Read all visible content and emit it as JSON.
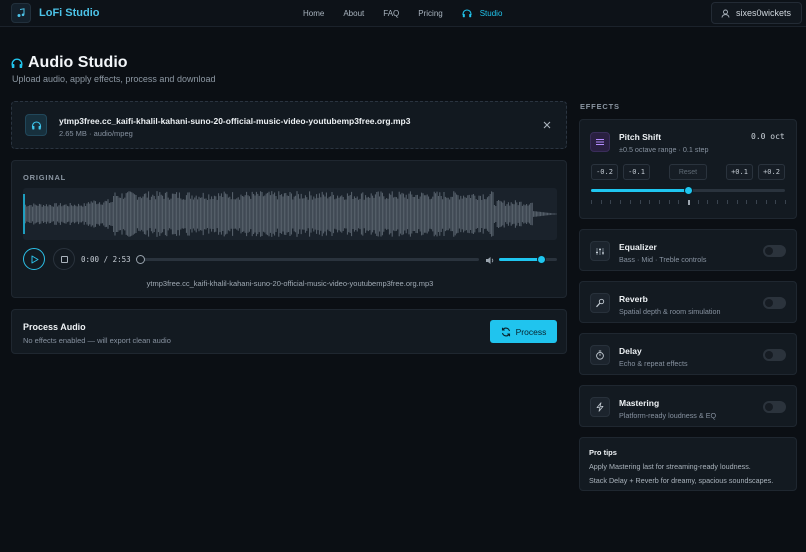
{
  "nav": {
    "brand": "LoFi Studio",
    "links": [
      "Home",
      "About",
      "FAQ",
      "Pricing"
    ],
    "active_link": "Studio",
    "username": "sixes0wickets"
  },
  "header": {
    "title": "Audio Studio",
    "subtitle": "Upload audio, apply effects, process and download"
  },
  "file": {
    "name": "ytmp3free.cc_kaifi-khalil-kahani-suno-20-official-music-video-youtubemp3free.org.mp3",
    "meta": "2.65 MB · audio/mpeg"
  },
  "player": {
    "label": "ORIGINAL",
    "time": "0:00 / 2:53",
    "progress": 0,
    "volume": 0.72,
    "filename": "ytmp3free.cc_kaifi-khalil-kahani-suno-20-official-music-video-youtubemp3free.org.mp3"
  },
  "process": {
    "title": "Process Audio",
    "subtitle": "No effects enabled — will export clean audio",
    "button": "Process"
  },
  "effects": {
    "label": "EFFECTS",
    "pitch": {
      "title": "Pitch Shift",
      "subtitle": "±0.5 octave range · 0.1 step",
      "value": "0.0 oct",
      "buttons": [
        "-0.2",
        "-0.1",
        "Reset",
        "+0.1",
        "+0.2"
      ],
      "position": 0.5
    },
    "items": [
      {
        "title": "Equalizer",
        "subtitle": "Bass · Mid · Treble controls",
        "enabled": false
      },
      {
        "title": "Reverb",
        "subtitle": "Spatial depth & room simulation",
        "enabled": false
      },
      {
        "title": "Delay",
        "subtitle": "Echo & repeat effects",
        "enabled": false
      },
      {
        "title": "Mastering",
        "subtitle": "Platform-ready loudness & EQ",
        "enabled": false
      }
    ]
  },
  "tips": {
    "title": "Pro tips",
    "lines": [
      "Apply Mastering last for streaming-ready loudness.",
      "Stack Delay + Reverb for dreamy, spacious soundscapes."
    ]
  },
  "colors": {
    "accent": "#20c4ee",
    "background": "#0b0f14",
    "card": "#131a21"
  }
}
